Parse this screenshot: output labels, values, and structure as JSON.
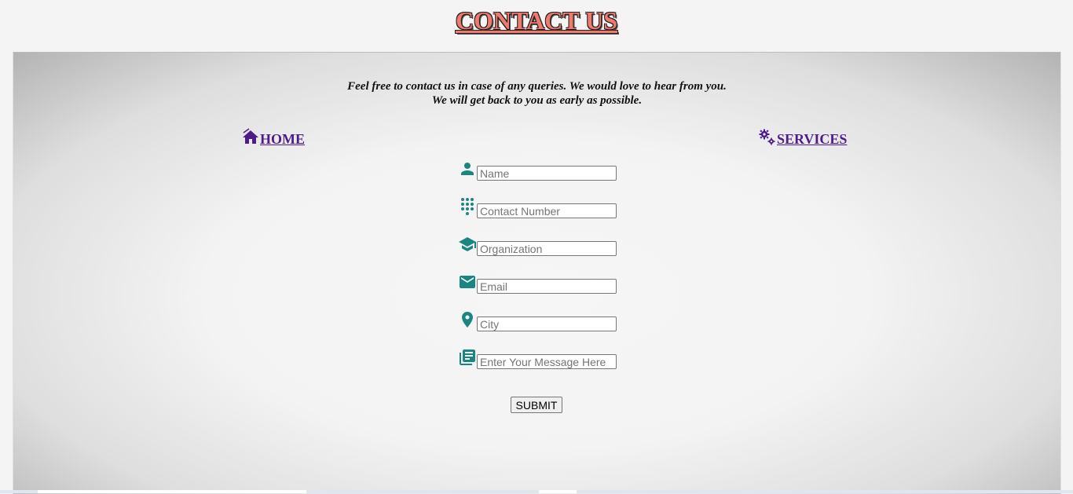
{
  "header": {
    "title": "CONTACT US"
  },
  "intro": {
    "line1": "Feel free to contact us in case of any queries. We would love to hear from you.",
    "line2": "We will get back to you as early as possible."
  },
  "nav": {
    "home_label": "HOME",
    "services_label": "SERVICES",
    "link_color": "#4e1c8a"
  },
  "form": {
    "icon_color": "#1a8583",
    "fields": [
      {
        "name": "name",
        "icon": "person-icon",
        "placeholder": "Name",
        "value": ""
      },
      {
        "name": "contact-number",
        "icon": "dialpad-icon",
        "placeholder": "Contact Number",
        "value": ""
      },
      {
        "name": "organization",
        "icon": "graduation-cap-icon",
        "placeholder": "Organization",
        "value": ""
      },
      {
        "name": "email",
        "icon": "envelope-icon",
        "placeholder": "Email",
        "value": ""
      },
      {
        "name": "city",
        "icon": "location-pin-icon",
        "placeholder": "City",
        "value": ""
      },
      {
        "name": "message",
        "icon": "article-icon",
        "placeholder": "Enter Your Message Here",
        "value": ""
      }
    ],
    "submit_label": "SUBMIT"
  },
  "colors": {
    "title_fill": "#f07a6e",
    "title_outline": "#222222"
  }
}
